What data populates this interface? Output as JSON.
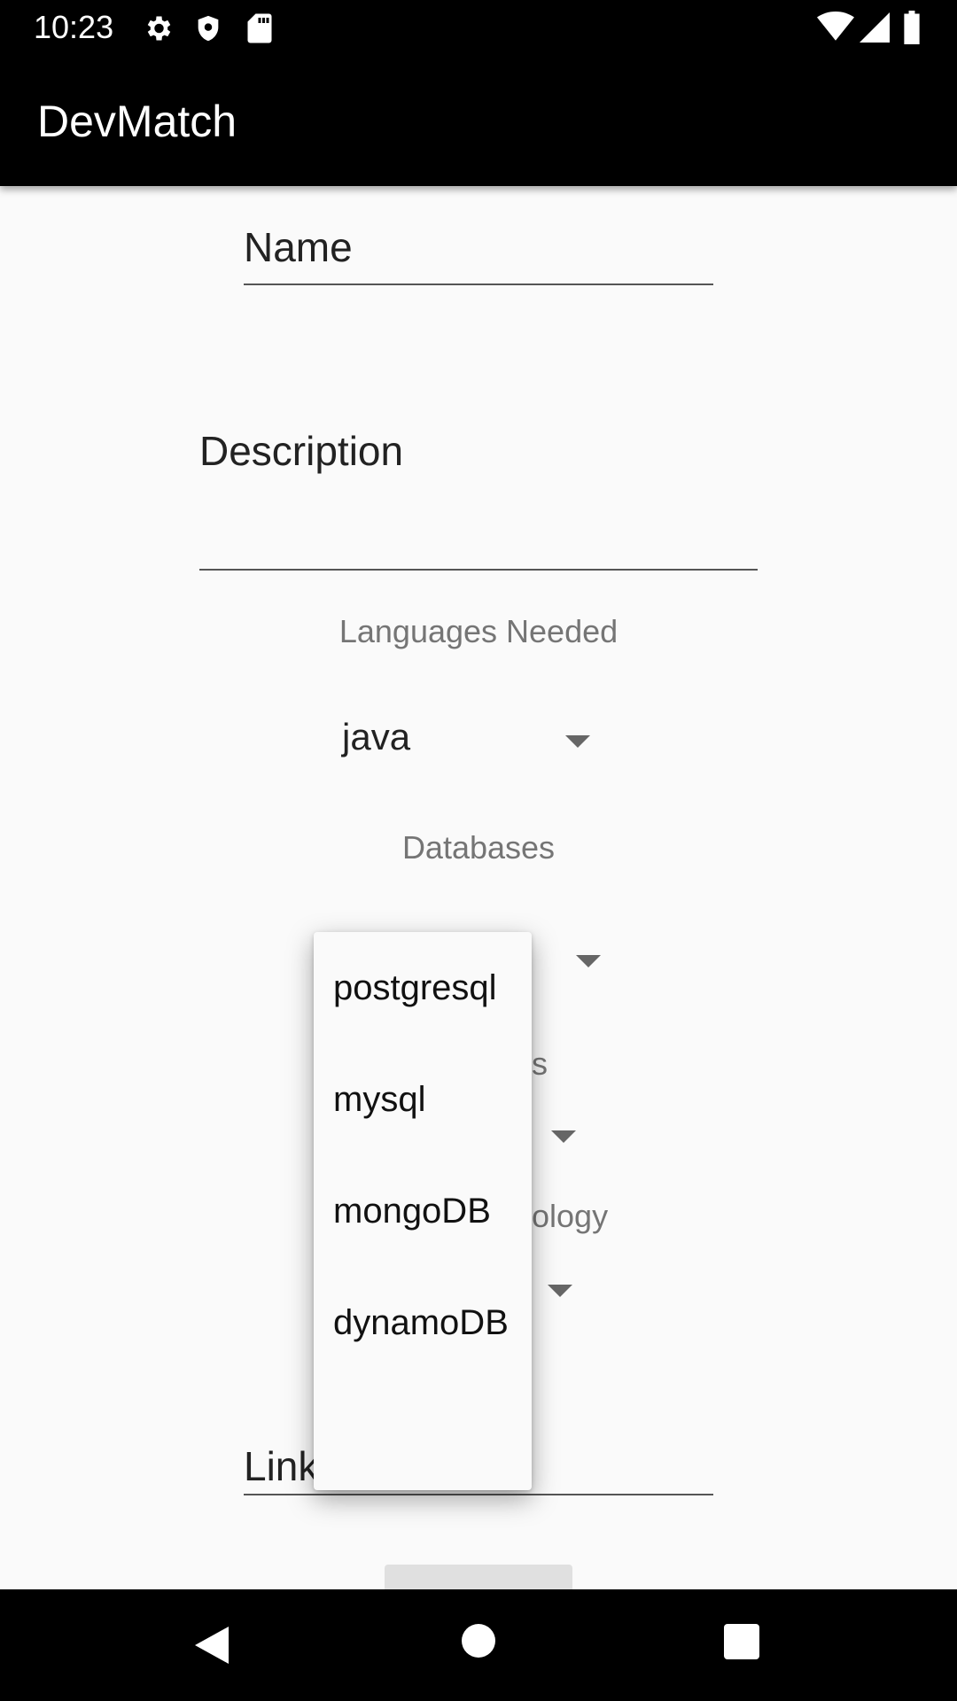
{
  "status_bar": {
    "time": "10:23",
    "left_icons": [
      "gear-icon",
      "shield-icon",
      "sd-card-icon"
    ],
    "right_icons": [
      "wifi-icon",
      "signal-icon",
      "battery-icon"
    ]
  },
  "app_bar": {
    "title": "DevMatch"
  },
  "form": {
    "name_field": {
      "placeholder": "Name"
    },
    "description_field": {
      "placeholder": "Description"
    },
    "languages": {
      "label": "Languages Needed",
      "selected": "java"
    },
    "databases": {
      "label": "Databases"
    },
    "frameworks": {
      "label_visible_fragment": "s"
    },
    "technology": {
      "label_visible_fragment": "ology"
    },
    "link_field": {
      "placeholder_visible_fragment": "Link"
    }
  },
  "dropdown": {
    "items": [
      "postgresql",
      "mysql",
      "mongoDB",
      "dynamoDB"
    ]
  },
  "nav_bar": {
    "buttons": [
      "back-icon",
      "home-icon",
      "recents-icon"
    ]
  }
}
